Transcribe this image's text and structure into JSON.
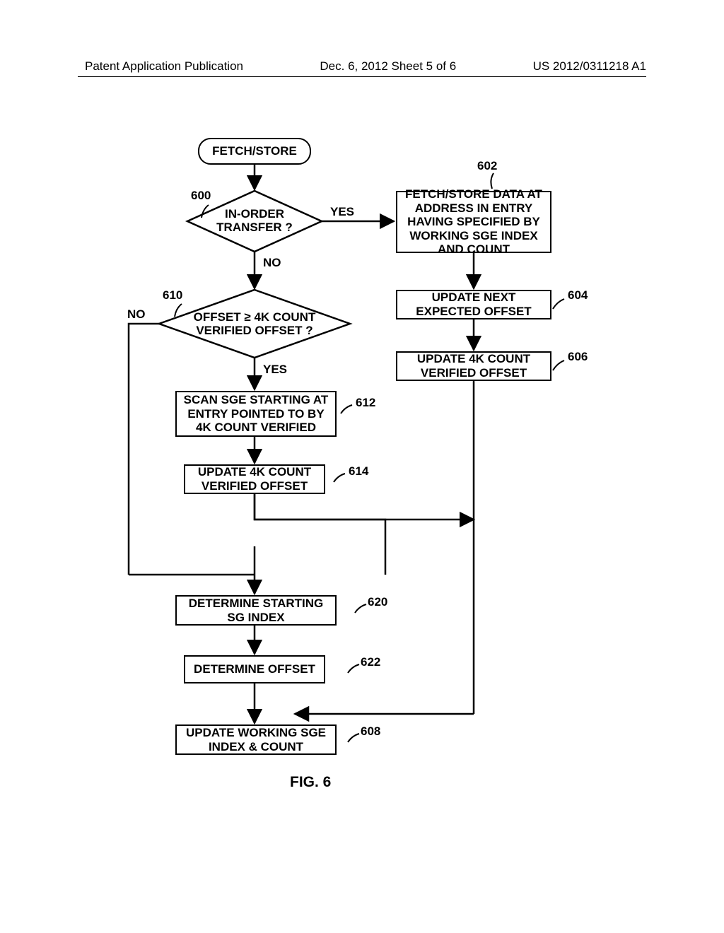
{
  "header": {
    "left": "Patent Application Publication",
    "center": "Dec. 6, 2012  Sheet 5 of 6",
    "right": "US 2012/0311218 A1"
  },
  "figure_label": "FIG. 6",
  "nodes": {
    "start": "FETCH/STORE",
    "d600": {
      "line1": "IN-ORDER",
      "line2": "TRANSFER ?"
    },
    "d610": {
      "line1": "OFFSET ≥ 4K COUNT",
      "line2": "VERIFIED OFFSET ?"
    },
    "b602": "FETCH/STORE DATA AT ADDRESS IN ENTRY HAVING SPECIFIED BY WORKING SGE INDEX AND COUNT",
    "b604": "UPDATE NEXT EXPECTED OFFSET",
    "b606": "UPDATE 4K COUNT VERIFIED OFFSET",
    "b612": "SCAN SGE STARTING AT ENTRY POINTED TO BY 4K COUNT VERIFIED",
    "b614": "UPDATE 4K COUNT VERIFIED OFFSET",
    "b620": "DETERMINE STARTING SG INDEX",
    "b622": "DETERMINE OFFSET",
    "b608": "UPDATE WORKING SGE INDEX & COUNT"
  },
  "edge_labels": {
    "yes600": "YES",
    "no600": "NO",
    "yes610": "YES",
    "no610": "NO"
  },
  "ref": {
    "r600": "600",
    "r602": "602",
    "r610": "610",
    "r604": "604",
    "r606": "606",
    "r612": "612",
    "r614": "614",
    "r620": "620",
    "r622": "622",
    "r608": "608"
  },
  "chart_data": {
    "type": "flowchart",
    "nodes": [
      {
        "id": "start",
        "type": "terminator",
        "label": "FETCH/STORE"
      },
      {
        "id": "600",
        "type": "decision",
        "label": "IN-ORDER TRANSFER ?"
      },
      {
        "id": "602",
        "type": "process",
        "label": "FETCH/STORE DATA AT ADDRESS IN ENTRY HAVING SPECIFIED BY WORKING SGE INDEX AND COUNT"
      },
      {
        "id": "604",
        "type": "process",
        "label": "UPDATE NEXT EXPECTED OFFSET"
      },
      {
        "id": "606",
        "type": "process",
        "label": "UPDATE 4K COUNT VERIFIED OFFSET"
      },
      {
        "id": "610",
        "type": "decision",
        "label": "OFFSET ≥ 4K COUNT VERIFIED OFFSET ?"
      },
      {
        "id": "612",
        "type": "process",
        "label": "SCAN SGE STARTING AT ENTRY POINTED TO BY 4K COUNT VERIFIED"
      },
      {
        "id": "614",
        "type": "process",
        "label": "UPDATE 4K COUNT VERIFIED OFFSET"
      },
      {
        "id": "620",
        "type": "process",
        "label": "DETERMINE STARTING SG INDEX"
      },
      {
        "id": "622",
        "type": "process",
        "label": "DETERMINE OFFSET"
      },
      {
        "id": "608",
        "type": "process",
        "label": "UPDATE WORKING SGE INDEX & COUNT"
      }
    ],
    "edges": [
      {
        "from": "start",
        "to": "600"
      },
      {
        "from": "600",
        "to": "602",
        "label": "YES"
      },
      {
        "from": "600",
        "to": "610",
        "label": "NO"
      },
      {
        "from": "602",
        "to": "604"
      },
      {
        "from": "604",
        "to": "606"
      },
      {
        "from": "606",
        "to": "608"
      },
      {
        "from": "610",
        "to": "612",
        "label": "YES"
      },
      {
        "from": "610",
        "to": "620",
        "label": "NO"
      },
      {
        "from": "612",
        "to": "614"
      },
      {
        "from": "614",
        "to": "620"
      },
      {
        "from": "620",
        "to": "622"
      },
      {
        "from": "622",
        "to": "608"
      }
    ]
  }
}
